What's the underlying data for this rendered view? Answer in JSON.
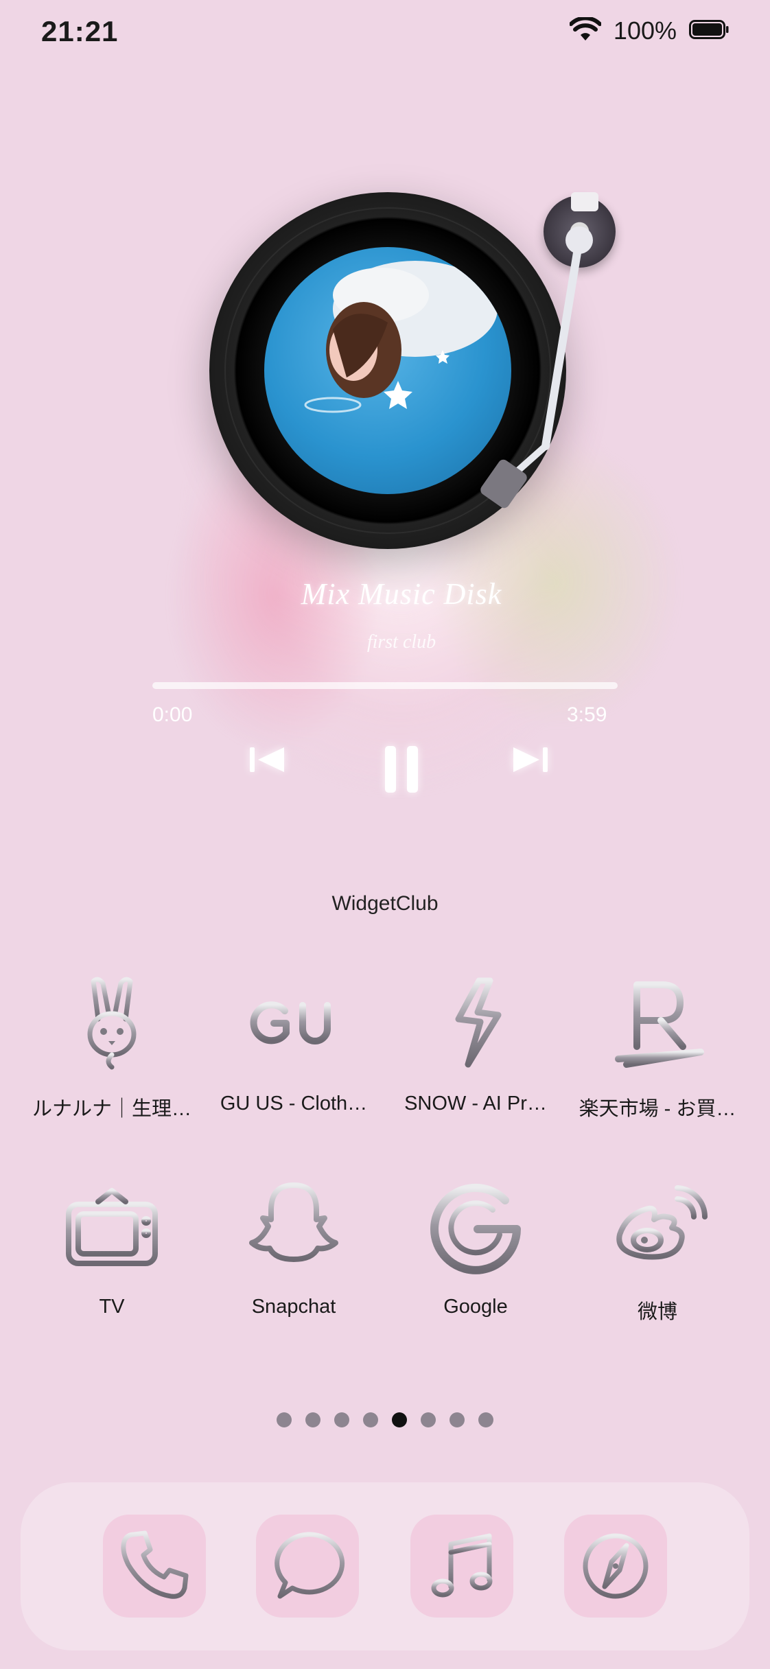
{
  "status_bar": {
    "time": "21:21",
    "battery_percent": "100%",
    "icons": [
      "wifi-icon",
      "battery-icon"
    ]
  },
  "widget": {
    "song_title": "Mix Music Disk",
    "artist": "first club",
    "elapsed": "0:00",
    "total": "3:59",
    "progress_fraction": 0,
    "controls": [
      "previous-icon",
      "pause-icon",
      "next-icon"
    ],
    "name": "WidgetClub"
  },
  "apps_row1": [
    {
      "label": "ルナルナ｜生理…",
      "icon": "rabbit-icon"
    },
    {
      "label": "GU US - Cloth…",
      "icon": "gu-logo-icon"
    },
    {
      "label": "SNOW - AI Pr…",
      "icon": "lightning-icon"
    },
    {
      "label": "楽天市場 - お買…",
      "icon": "rakuten-r-icon"
    }
  ],
  "apps_row2": [
    {
      "label": "TV",
      "icon": "tv-icon"
    },
    {
      "label": "Snapchat",
      "icon": "ghost-icon"
    },
    {
      "label": "Google",
      "icon": "google-g-icon"
    },
    {
      "label": "微博",
      "icon": "weibo-icon"
    }
  ],
  "page_indicator": {
    "count": 8,
    "active_index": 4
  },
  "dock": [
    "phone-icon",
    "messages-icon",
    "music-icon",
    "compass-icon"
  ],
  "colors": {
    "background": "#efd6e5",
    "chrome_stroke": "#7d7a82",
    "chrome_highlight": "#e8e6ea"
  }
}
